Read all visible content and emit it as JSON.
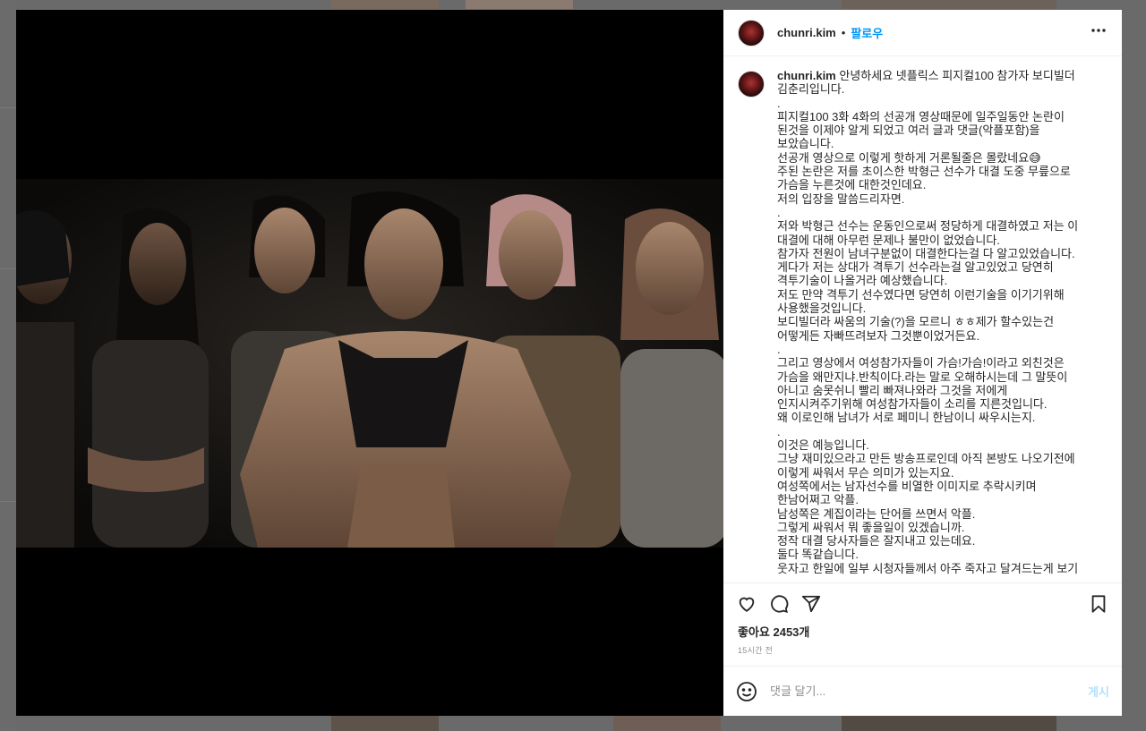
{
  "header": {
    "username": "chunri.kim",
    "separator": "•",
    "follow_label": "팔로우",
    "more_icon": "more-horizontal-icon"
  },
  "caption": {
    "username": "chunri.kim",
    "text": " 안녕하세요 넷플릭스 피지컬100 참가자 보디빌더 김춘리입니다.\n.\n피지컬100 3화 4화의 선공개 영상때문에 일주일동안 논란이 된것을 이제야 알게 되었고 여러 글과 댓글(악플포함)을 보았습니다.\n선공개 영상으로 이렇게 핫하게 거론될줄은 몰랐네요😅\n주된 논란은 저를 초이스한 박형근 선수가 대결 도중 무릎으로 가슴을 누른것에 대한것인데요.\n저의 입장을 말씀드리자면.\n.\n저와 박형근 선수는 운동인으로써 정당하게 대결하였고 저는 이 대결에 대해 아무런 문제나 불만이 없었습니다.\n참가자 전원이 남녀구분없이 대결한다는걸 다 알고있었습니다.\n게다가 저는 상대가 격투기 선수라는걸 알고있었고 당연히 격투기술이 나올거라 예상했습니다.\n저도 만약 격투기 선수였다면 당연히 이런기술을 이기기위해 사용했을것입니다.\n보디빌더라 싸움의 기술(?)을 모르니 ㅎㅎ제가 할수있는건 어떻게든 자빠뜨려보자 그것뿐이었거든요.\n.\n그리고 영상에서 여성참가자들이 가슴!가슴!이라고 외친것은 가슴을 왜만지냐.반칙이다.라는 말로 오해하시는데 그 말뜻이 아니고 숨못쉬니 빨리 빠져나와라 그것을 저에게 인지시켜주기위해 여성참가자들이 소리를 지른것입니다.\n왜 이로인해 남녀가 서로 페미니 한남이니 싸우시는지.\n.\n이것은 예능입니다.\n그냥 재미있으라고 만든 방송프로인데 아직 본방도 나오기전에 이렇게 싸워서 무슨 의미가 있는지요.\n여성쪽에서는 남자선수를 비열한 이미지로 추락시키며 한남어쩌고 악플.\n남성쪽은 계집이라는 단어를 쓰면서 악플.\n그렇게 싸워서 뭐 좋을일이 있겠습니까.\n정작 대결 당사자들은 잘지내고 있는데요.\n둘다 똑같습니다.\n웃자고 한일에 일부 시청자들께서 아주 죽자고 달겨드는게 보기"
  },
  "actions": {
    "like_icon": "heart-icon",
    "comment_icon": "comment-icon",
    "share_icon": "paper-plane-icon",
    "save_icon": "bookmark-icon"
  },
  "likes_text": "좋아요 2453개",
  "time_text": "15시간 전",
  "comment": {
    "emoji_icon": "smiley-icon",
    "placeholder": "댓글 달기...",
    "post_label": "게시"
  },
  "colors": {
    "accent": "#0095f6",
    "post_disabled": "#b2dffc",
    "text": "#262626",
    "muted": "#8e8e8e"
  }
}
